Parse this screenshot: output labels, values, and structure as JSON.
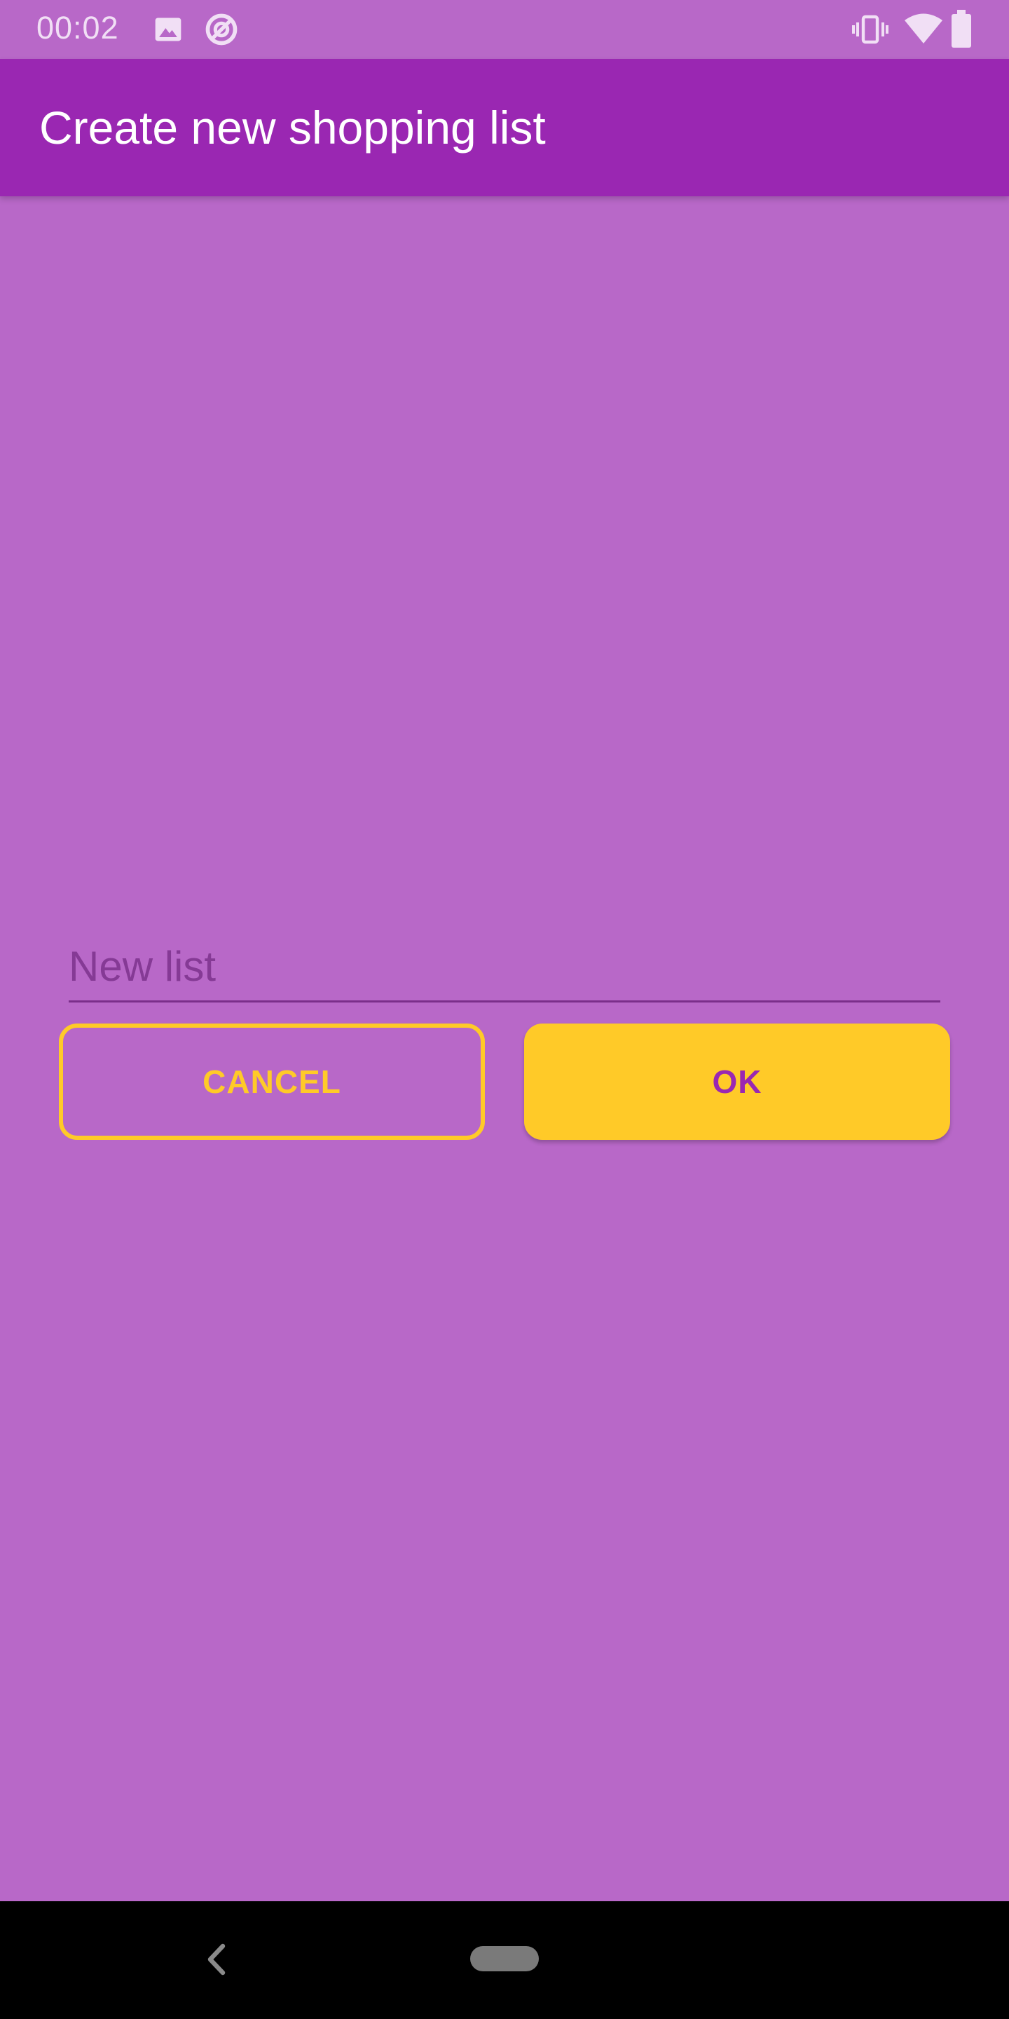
{
  "status_bar": {
    "time": "00:02",
    "left_icons": [
      "image-icon",
      "data-saver-icon"
    ],
    "right_icons": [
      "vibrate-icon",
      "wifi-icon",
      "battery-icon"
    ]
  },
  "app_bar": {
    "title": "Create new shopping list",
    "color": "#9a27b2"
  },
  "form": {
    "list_name": {
      "value": "",
      "placeholder": "New list"
    },
    "cancel_label": "CANCEL",
    "ok_label": "OK"
  },
  "nav_bar": {
    "icons": [
      "back-icon",
      "home-pill-icon"
    ]
  },
  "colors": {
    "background": "#b868c8",
    "primary": "#9a27b2",
    "accent": "#ffca28"
  }
}
